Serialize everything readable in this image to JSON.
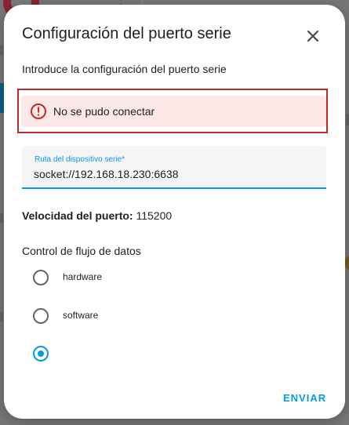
{
  "dialog": {
    "title": "Configuración del puerto serie",
    "intro": "Introduce la configuración del puerto serie"
  },
  "alert": {
    "message": "No se pudo conectar",
    "icon": "alert-circle-outline-icon",
    "color": "#c62828"
  },
  "device_path": {
    "label": "Ruta del dispositivo serie*",
    "value": "socket://192.168.18.230:6638"
  },
  "speed": {
    "label": "Velocidad del puerto:",
    "value": "115200"
  },
  "flow_control": {
    "heading": "Control de flujo de datos",
    "options": [
      {
        "label": "hardware",
        "selected": false
      },
      {
        "label": "software",
        "selected": false
      },
      {
        "label": "",
        "selected": true
      }
    ]
  },
  "actions": {
    "submit_label": "ENVIAR"
  },
  "colors": {
    "accent": "#039be5",
    "error_bg": "#fce8e6",
    "error_border": "#c62828"
  }
}
